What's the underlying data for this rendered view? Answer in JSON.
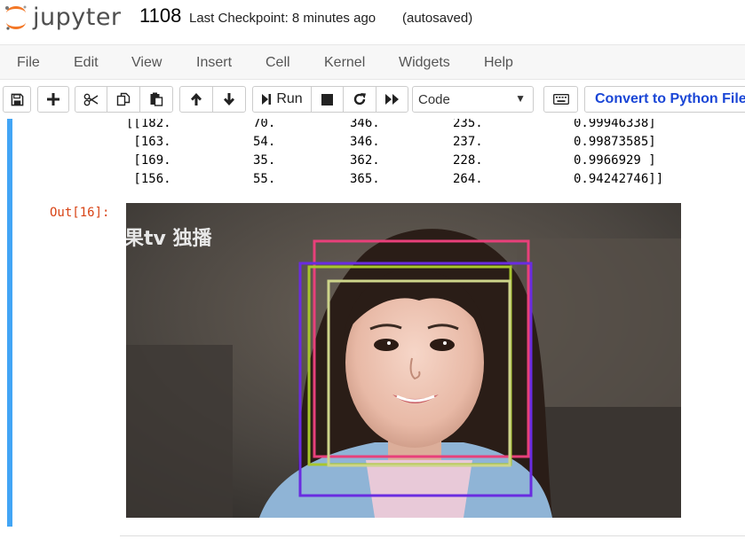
{
  "header": {
    "logo_text": "jupyter",
    "notebook_name": "1108",
    "checkpoint": "Last Checkpoint: 8 minutes ago",
    "autosave": "(autosaved)"
  },
  "menu": [
    "File",
    "Edit",
    "View",
    "Insert",
    "Cell",
    "Kernel",
    "Widgets",
    "Help"
  ],
  "toolbar": {
    "save_icon": "floppy-disk-icon",
    "add_icon": "plus-icon",
    "cut_icon": "scissors-icon",
    "copy_icon": "copy-icon",
    "paste_icon": "paste-icon",
    "up_icon": "arrow-up-icon",
    "down_icon": "arrow-down-icon",
    "run_label": "Run",
    "stop_icon": "stop-icon",
    "restart_icon": "restart-icon",
    "fast_forward_icon": "fast-forward-icon",
    "cell_type": "Code",
    "keyboard_icon": "keyboard-icon",
    "convert_label": "Convert to Python File"
  },
  "output": {
    "array_rows": [
      [
        "[[182.",
        "70.",
        "346.",
        "235.",
        "0.99946338]"
      ],
      [
        " [163.",
        "54.",
        "346.",
        "237.",
        "0.99873585]"
      ],
      [
        " [169.",
        "35.",
        "362.",
        "228.",
        "0.9966929 ]"
      ],
      [
        " [156.",
        "55.",
        "365.",
        "264.",
        "0.94242746]]"
      ]
    ],
    "out_prompt": "Out[16]:",
    "image_watermark": "果tv 独播",
    "box_colors": [
      "#e8407a",
      "#6a2ce0",
      "#a8c62e",
      "#cdd48a"
    ]
  }
}
